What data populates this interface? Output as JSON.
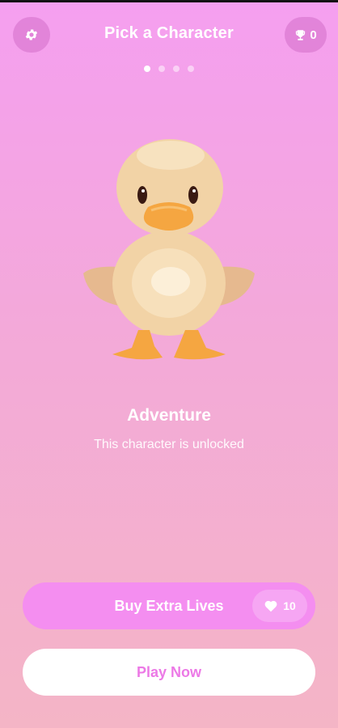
{
  "header": {
    "title": "Pick a Character",
    "trophy_count": "0",
    "settings_icon": "gear-icon",
    "trophy_icon": "trophy-icon"
  },
  "carousel": {
    "page_count": 4,
    "current_page": 1
  },
  "character": {
    "name": "Adventure",
    "status": "This character is unlocked",
    "image": "duck-character"
  },
  "actions": {
    "buy_label": "Buy Extra Lives",
    "lives_count": "10",
    "lives_icon": "heart-icon",
    "play_label": "Play Now"
  },
  "colors": {
    "accent": "#f48ef0",
    "play_text": "#ec79e6"
  }
}
